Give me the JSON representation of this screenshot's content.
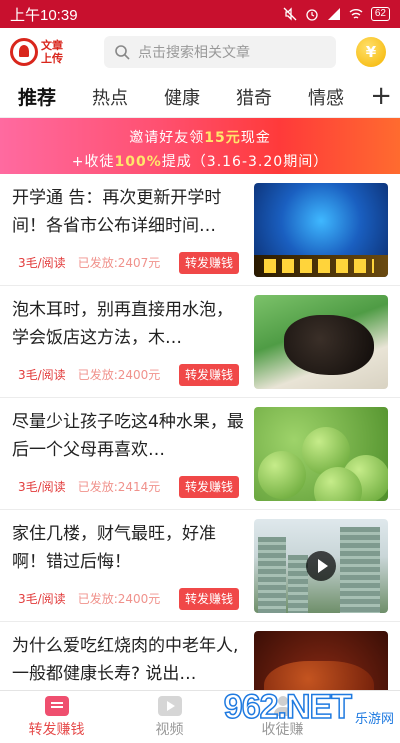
{
  "status_bar": {
    "time": "上午10:39",
    "battery": "62"
  },
  "header": {
    "logo_line1": "文章",
    "logo_line2": "上传",
    "search_placeholder": "点击搜索相关文章"
  },
  "tabs": [
    "推荐",
    "热点",
    "健康",
    "猎奇",
    "情感"
  ],
  "banner": {
    "line1_a": "邀请好友领",
    "line1_hl": "15元",
    "line1_b": "现金",
    "line2_a": "+收徒",
    "line2_hl": "100%",
    "line2_b": "提成（3.16-3.20期间）"
  },
  "articles": [
    {
      "title": "开学通 告：再次更新开学时间！各省市公布详细时间…",
      "price": "3毛/阅读",
      "reads": "已发放:2407元",
      "share": "转发赚钱"
    },
    {
      "title": "泡木耳时，别再直接用水泡，学会饭店这方法，木…",
      "price": "3毛/阅读",
      "reads": "已发放:2400元",
      "share": "转发赚钱"
    },
    {
      "title": "尽量少让孩子吃这4种水果，最后一个父母再喜欢…",
      "price": "3毛/阅读",
      "reads": "已发放:2414元",
      "share": "转发赚钱"
    },
    {
      "title": "家住几楼，财气最旺，好准啊！错过后悔！",
      "price": "3毛/阅读",
      "reads": "已发放:2400元",
      "share": "转发赚钱"
    },
    {
      "title": "为什么爱吃红烧肉的中老年人,一般都健康长寿? 说出…",
      "price": "",
      "reads": "",
      "share": ""
    }
  ],
  "bottom_nav": [
    {
      "label": "转发赚钱",
      "active": true
    },
    {
      "label": "视频",
      "active": false
    },
    {
      "label": "收徒赚",
      "active": false
    }
  ],
  "watermark": {
    "number": "962.NET",
    "sub": "乐游网"
  },
  "colors": {
    "status_bar": "#c8102e",
    "accent": "#e64a4a",
    "share_button": "#f04848"
  }
}
